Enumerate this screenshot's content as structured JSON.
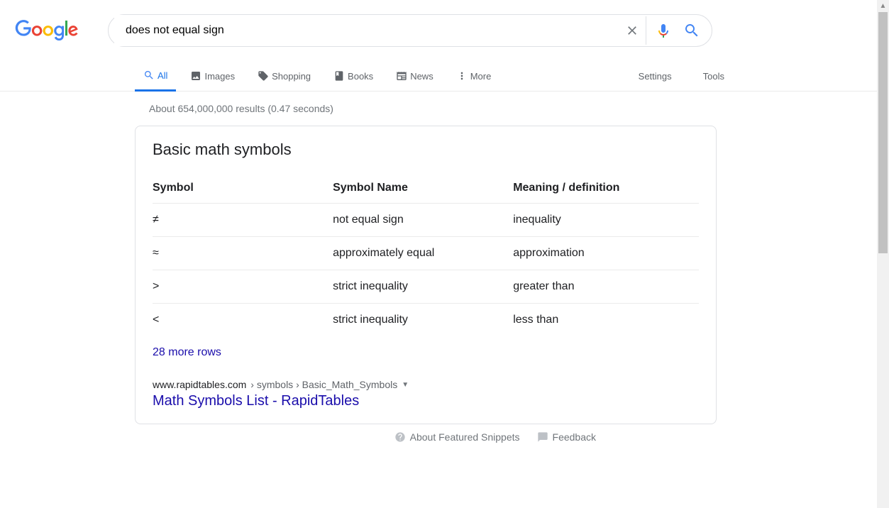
{
  "search": {
    "query": "does not equal sign",
    "placeholder": ""
  },
  "nav": {
    "all": "All",
    "images": "Images",
    "shopping": "Shopping",
    "books": "Books",
    "news": "News",
    "more": "More",
    "settings": "Settings",
    "tools": "Tools"
  },
  "stats": "About 654,000,000 results (0.47 seconds)",
  "snippet": {
    "title": "Basic math symbols",
    "headers": [
      "Symbol",
      "Symbol Name",
      "Meaning / definition"
    ],
    "rows": [
      {
        "symbol": "≠",
        "name": "not equal sign",
        "meaning": "inequality"
      },
      {
        "symbol": "≈",
        "name": "approximately equal",
        "meaning": "approximation"
      },
      {
        "symbol": ">",
        "name": "strict inequality",
        "meaning": "greater than"
      },
      {
        "symbol": "<",
        "name": "strict inequality",
        "meaning": "less than"
      }
    ],
    "more": "28 more rows"
  },
  "result": {
    "domain": "www.rapidtables.com",
    "crumbs": " › symbols › Basic_Math_Symbols",
    "title": "Math Symbols List - RapidTables"
  },
  "footer": {
    "about": "About Featured Snippets",
    "feedback": "Feedback"
  }
}
